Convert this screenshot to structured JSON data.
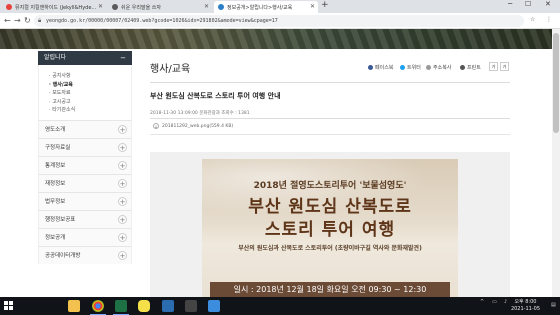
{
  "browser": {
    "tabs": [
      {
        "label": "뮤지컬 지킬앤하이드 (Jekyll&Hyde...",
        "active": false,
        "color": "#e8403b"
      },
      {
        "label": "쉬운 우리말을 쓰자",
        "active": false,
        "color": "#5a5a5a"
      },
      {
        "label": "정보공개>알립니다>행사/교육",
        "active": true,
        "color": "#2a7fc7"
      }
    ],
    "new_tab": "+",
    "window_controls": [
      "─",
      "☐",
      "✕"
    ],
    "nav": {
      "back": "←",
      "forward": "→",
      "reload": "↻"
    },
    "url": "yeongdo.go.kr/00000/00007/02409.web?gcode=1026&idx=291802&amode=view&cpage=17"
  },
  "sidebar": {
    "header": "알립니다",
    "header_toggle": "−",
    "sub_items": [
      {
        "label": "공지사항",
        "active": false
      },
      {
        "label": "행사/교육",
        "active": true
      },
      {
        "label": "보도자료",
        "active": false
      },
      {
        "label": "고시공고",
        "active": false
      },
      {
        "label": "타기관소식",
        "active": false
      }
    ],
    "items": [
      "영도소개",
      "구정자료실",
      "통계정보",
      "재정정보",
      "법무정보",
      "행정정보공표",
      "정보공개",
      "공공데이터개방"
    ],
    "plus": "+"
  },
  "main": {
    "page_title": "행사/교육",
    "share": {
      "facebook": "페이스북",
      "twitter": "트위터",
      "copy_url": "주소복사",
      "print": "프린트"
    },
    "font_buttons": [
      "가",
      "가"
    ],
    "post_title": "부산 원도심 산복도로 스토리 투어 여행 안내",
    "meta": "2018-11-30 13:09:00    문화관광과    조회수 : 1381",
    "attachment": "201811292_web.png(559.4 KB)",
    "poster": {
      "subtitle": "2018년 절영도스토리투어 '보물섬영도'",
      "title_line1": "부산 원도심 산복도로",
      "title_line2": "스토리 투어 여행",
      "description": "부산의 원도심과 산복도로 스토리투어 (초량이바구길 역사와 문화재발견)",
      "date": "일시 : 2018년 12월 18일 화요일 오전 09:30 ~ 12:30"
    }
  },
  "taskbar": {
    "time": "오후 8:00",
    "date": "2021-11-05",
    "icons": [
      "folder-icon",
      "chrome-icon",
      "excel-icon",
      "kakaotalk-icon",
      "app-icon",
      "app-icon-2",
      "app-icon-3"
    ]
  }
}
